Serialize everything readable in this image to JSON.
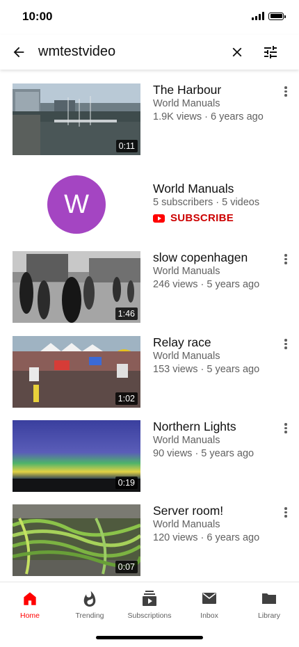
{
  "status_bar": {
    "time": "10:00"
  },
  "search": {
    "query": "wmtestvideo"
  },
  "results": [
    {
      "kind": "video",
      "title": "The Harbour",
      "channel": "World Manuals",
      "views": "1.9K views · 6 years ago",
      "duration": "0:11",
      "thumbnail": "harbour-thumbnail"
    },
    {
      "kind": "channel",
      "name": "World Manuals",
      "avatar_letter": "W",
      "avatar_color": "#a445c2",
      "stats": "5 subscribers · 5 videos",
      "subscribe_label": "SUBSCRIBE"
    },
    {
      "kind": "video",
      "title": "slow copenhagen",
      "channel": "World Manuals",
      "views": "246 views · 5 years ago",
      "duration": "1:46",
      "thumbnail": "street-thumbnail"
    },
    {
      "kind": "video",
      "title": "Relay race",
      "channel": "World Manuals",
      "views": "153 views · 5 years ago",
      "duration": "1:02",
      "thumbnail": "race-thumbnail"
    },
    {
      "kind": "video",
      "title": "Northern Lights",
      "channel": "World Manuals",
      "views": "90 views · 5 years ago",
      "duration": "0:19",
      "thumbnail": "aurora-thumbnail"
    },
    {
      "kind": "video",
      "title": "Server room!",
      "channel": "World Manuals",
      "views": "120 views · 6 years ago",
      "duration": "0:07",
      "thumbnail": "server-thumbnail"
    }
  ],
  "bottom_nav": {
    "items": [
      {
        "label": "Home",
        "icon": "home-icon",
        "active": true
      },
      {
        "label": "Trending",
        "icon": "flame-icon",
        "active": false
      },
      {
        "label": "Subscriptions",
        "icon": "subscriptions-icon",
        "active": false
      },
      {
        "label": "Inbox",
        "icon": "mail-icon",
        "active": false
      },
      {
        "label": "Library",
        "icon": "folder-icon",
        "active": false
      }
    ]
  },
  "colors": {
    "accent": "#ff0000",
    "subscribe_text": "#cc0000",
    "secondary_text": "#606060"
  }
}
